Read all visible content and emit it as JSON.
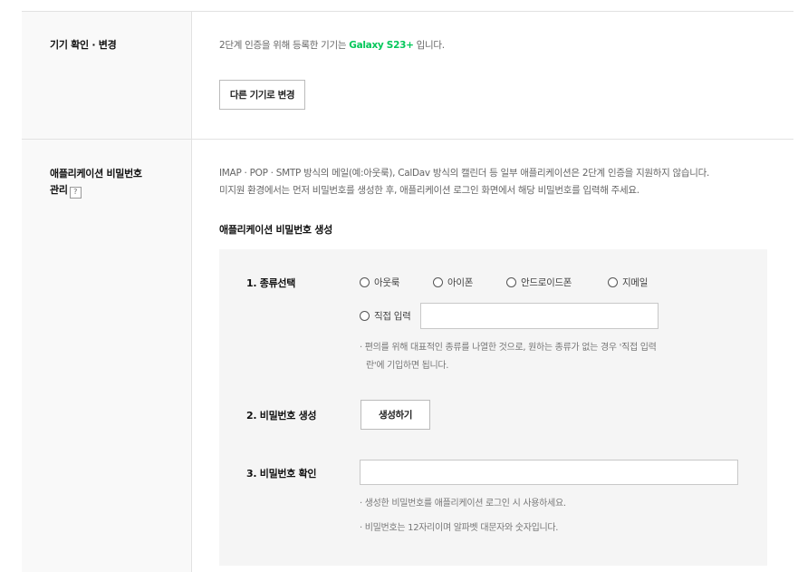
{
  "device_section": {
    "label": "기기 확인 · 변경",
    "desc_prefix": "2단계 인증을 위해 등록한 기기는 ",
    "device_name": "Galaxy S23+",
    "desc_suffix": " 입니다.",
    "change_button": "다른 기기로 변경"
  },
  "app_password_section": {
    "label_line1": "애플리케이션 비밀번호",
    "label_line2": "관리",
    "help_mark": "?",
    "desc_line1": "IMAP · POP · SMTP 방식의 메일(예:아웃룩), CalDav 방식의 캘린더 등 일부 애플리케이션은 2단계 인증을 지원하지 않습니다.",
    "desc_line2": "미지원 환경에서는 먼저 비밀번호를 생성한 후, 애플리케이션 로그인 화면에서 해당 비밀번호를 입력해 주세요.",
    "subheading": "애플리케이션 비밀번호 생성",
    "step1": {
      "label": "1. 종류선택",
      "options": [
        "아웃룩",
        "아이폰",
        "안드로이드폰",
        "지메일"
      ],
      "custom_option": "직접 입력",
      "custom_value": "",
      "note_line1": "· 편의를 위해 대표적인 종류를 나열한 것으로, 원하는 종류가 없는 경우 '직접 입력",
      "note_line2": "란'에 기입하면 됩니다."
    },
    "step2": {
      "label": "2. 비밀번호 생성",
      "button": "생성하기"
    },
    "step3": {
      "label": "3. 비밀번호 확인",
      "value": "",
      "note1": "· 생성한 비밀번호를 애플리케이션 로그인 시 사용하세요.",
      "note2": "· 비밀번호는 12자리이며 알파벳 대문자와 숫자입니다."
    }
  }
}
